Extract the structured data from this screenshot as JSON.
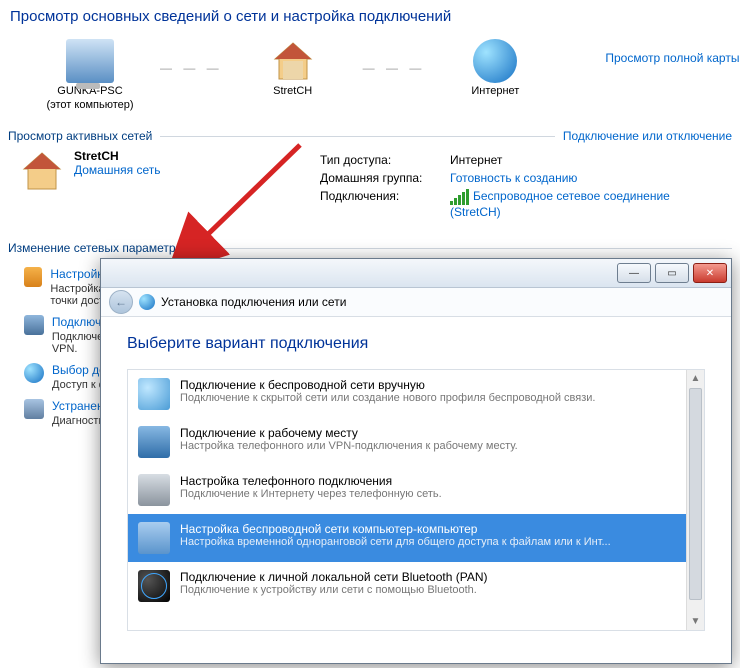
{
  "header": {
    "title": "Просмотр основных сведений о сети и настройка подключений"
  },
  "netmap": {
    "pc": {
      "name": "GUNKA-PSC",
      "sub": "(этот компьютер)"
    },
    "router": {
      "name": "StretCH"
    },
    "internet": {
      "name": "Интернет"
    },
    "full_map_link": "Просмотр полной карты"
  },
  "sections": {
    "active": {
      "label": "Просмотр активных сетей",
      "rlink": "Подключение или отключение"
    },
    "change": {
      "label": "Изменение сетевых параметров"
    }
  },
  "active_network": {
    "name": "StretCH",
    "type_link": "Домашняя сеть",
    "rows": {
      "access": {
        "k": "Тип доступа:",
        "v": "Интернет"
      },
      "homegroup": {
        "k": "Домашняя группа:",
        "v": "Готовность к созданию"
      },
      "conn": {
        "k": "Подключения:",
        "v": "Беспроводное сетевое соединение (StretCH)"
      }
    }
  },
  "tasks": [
    {
      "title": "Настройка нового подключения или сети",
      "desc": "Настройка беспроводного, широкополосного, модемного, прямого или VPN-подключения или же настройка маршрутизатора или точки доступа."
    },
    {
      "title": "Подключиться к сети",
      "desc": "Подключение или повторное подключение к беспроводному, проводному, модемному сетевому соединению или подключение к VPN."
    },
    {
      "title": "Выбор домашней группы и параметров общего доступа",
      "desc": "Доступ к файлам и принтерам, расположенным на других сетевых компьютерах, или изменение параметров общего доступа."
    },
    {
      "title": "Устранение неполадок",
      "desc": "Диагностика и исправление сетевых проблем или получение сведений."
    }
  ],
  "wizard": {
    "title": "Установка подключения или сети",
    "heading": "Выберите вариант подключения",
    "options": [
      {
        "t": "Подключение к беспроводной сети вручную",
        "d": "Подключение к скрытой сети или создание нового профиля беспроводной связи.",
        "ico": "ico-wifi"
      },
      {
        "t": "Подключение к рабочему месту",
        "d": "Настройка телефонного или VPN-подключения к рабочему месту.",
        "ico": "ico-work"
      },
      {
        "t": "Настройка телефонного подключения",
        "d": "Подключение к Интернету через телефонную сеть.",
        "ico": "ico-phone"
      },
      {
        "t": "Настройка беспроводной сети компьютер-компьютер",
        "d": "Настройка временной одноранговой сети для общего доступа к файлам или к Инт...",
        "ico": "ico-adhoc",
        "selected": true
      },
      {
        "t": "Подключение к личной локальной сети Bluetooth (PAN)",
        "d": "Подключение к устройству или сети с помощью Bluetooth.",
        "ico": "ico-bt"
      }
    ]
  }
}
